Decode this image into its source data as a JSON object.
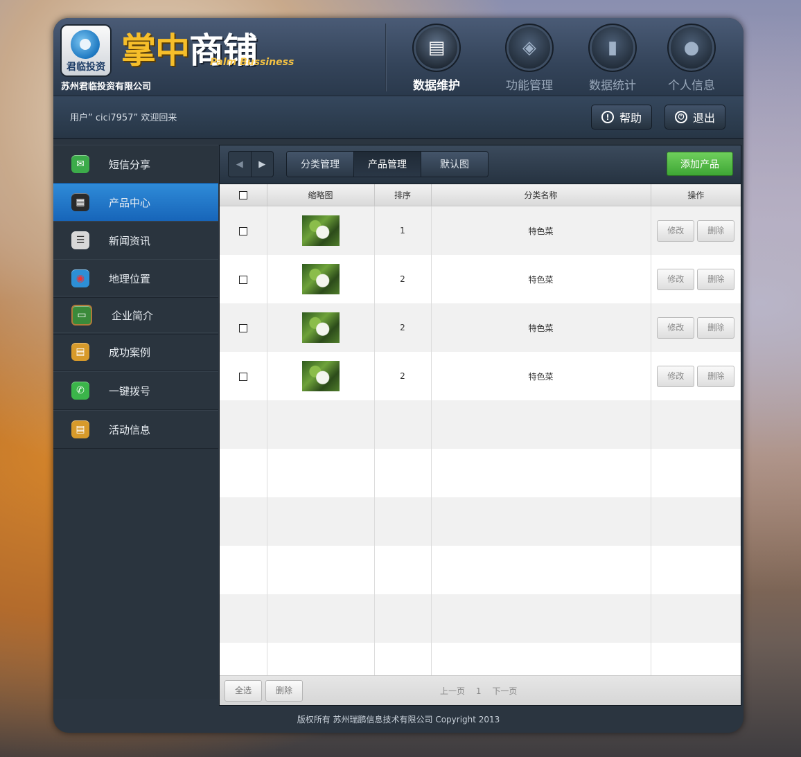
{
  "brand": {
    "logo_text": "君临投资",
    "title_main": "掌中",
    "title_sub": "商铺",
    "title_en": "Palm Bussiness",
    "company": "苏州君临投资有限公司"
  },
  "topnav": [
    {
      "label": "数据维护",
      "icon": "document-icon",
      "active": true
    },
    {
      "label": "功能管理",
      "icon": "box-icon",
      "active": false
    },
    {
      "label": "数据统计",
      "icon": "chart-icon",
      "active": false
    },
    {
      "label": "个人信息",
      "icon": "user-icon",
      "active": false
    }
  ],
  "userbar": {
    "welcome": "用户” cici7957” 欢迎回来",
    "help": "帮助",
    "logout": "退出"
  },
  "sidebar": {
    "items": [
      {
        "label": "短信分享",
        "icon": "sms-icon",
        "color": "#3cab4a"
      },
      {
        "label": "产品中心",
        "icon": "apps-icon",
        "color": "#2a2a2a",
        "active": true
      },
      {
        "label": "新闻资讯",
        "icon": "news-icon",
        "color": "#d8d8d8"
      },
      {
        "label": "地理位置",
        "icon": "map-pin-icon",
        "color": "#2d8fd6"
      },
      {
        "label": "企业简介",
        "icon": "board-icon",
        "color": "#3a8a3a"
      },
      {
        "label": "成功案例",
        "icon": "case-icon",
        "color": "#d79a2b"
      },
      {
        "label": "一键拨号",
        "icon": "phone-icon",
        "color": "#3bb54a"
      },
      {
        "label": "活动信息",
        "icon": "case-icon",
        "color": "#d79a2b"
      }
    ]
  },
  "toolbar": {
    "tabs": [
      "分类管理",
      "产品管理",
      "默认图"
    ],
    "active_tab": 1,
    "add_button": "添加产品"
  },
  "table": {
    "headers": [
      "缩略图",
      "排序",
      "分类名称",
      "操作"
    ],
    "rows": [
      {
        "order": "1",
        "category": "特色菜"
      },
      {
        "order": "2",
        "category": "特色菜"
      },
      {
        "order": "2",
        "category": "特色菜"
      },
      {
        "order": "2",
        "category": "特色菜"
      }
    ],
    "edit_label": "修改",
    "delete_label": "删除",
    "empty_rows": 6
  },
  "footer": {
    "select_all": "全选",
    "delete": "删除",
    "prev": "上一页",
    "page": "1",
    "next": "下一页"
  },
  "copyright": "版权所有 苏州瑞鹏信息技术有限公司 Copyright 2013"
}
